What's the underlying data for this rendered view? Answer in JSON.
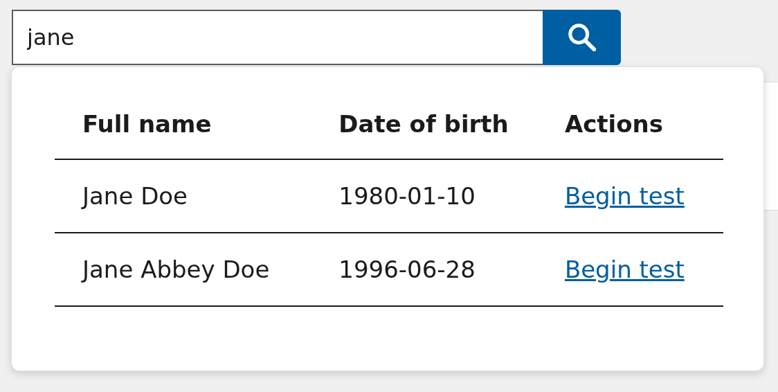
{
  "search": {
    "value": "jane"
  },
  "results": {
    "columns": [
      "Full name",
      "Date of birth",
      "Actions"
    ],
    "rows": [
      {
        "full_name": "Jane Doe",
        "date_of_birth": "1980-01-10",
        "action": "Begin test"
      },
      {
        "full_name": "Jane Abbey Doe",
        "date_of_birth": "1996-06-28",
        "action": "Begin test"
      }
    ]
  }
}
